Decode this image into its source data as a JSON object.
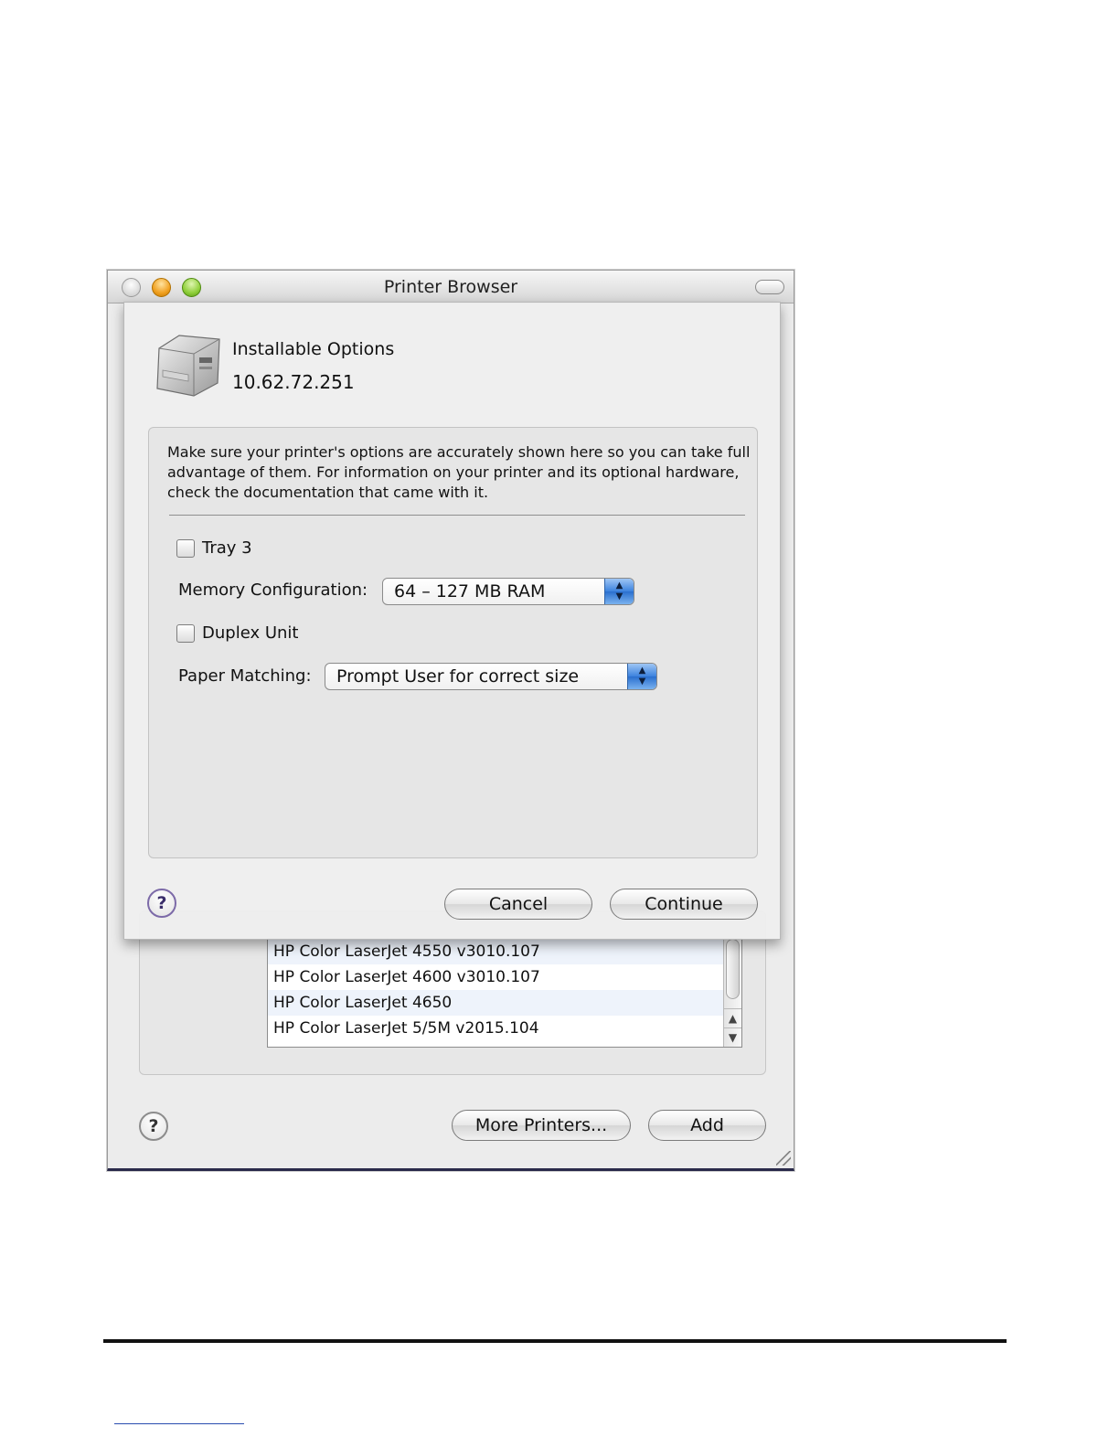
{
  "window": {
    "title": "Printer Browser",
    "help_label": "?",
    "more_printers_label": "More Printers...",
    "add_label": "Add"
  },
  "printer_list": {
    "rows": [
      "HP Color LaserJet 4550 v3010.107",
      "HP Color LaserJet 4600 v3010.107",
      "HP Color LaserJet 4650",
      "HP Color LaserJet 5/5M v2015.104"
    ],
    "scroll_up_icon": "triangle-up-icon",
    "scroll_down_icon": "triangle-down-icon"
  },
  "sheet": {
    "title": "Installable Options",
    "address": "10.62.72.251",
    "printer_icon": "laser-printer-icon",
    "instructions": "Make sure your printer's options are accurately shown here so you can take full advantage of them.  For information on your printer and its optional hardware, check the documentation that came with it.",
    "tray3_label": "Tray 3",
    "tray3_checked": false,
    "memory_label": "Memory Configuration:",
    "memory_value": "64 – 127 MB RAM",
    "duplex_label": "Duplex Unit",
    "duplex_checked": false,
    "paper_label": "Paper Matching:",
    "paper_value": "Prompt User for correct size",
    "help_label": "?",
    "cancel_label": "Cancel",
    "continue_label": "Continue"
  },
  "colors": {
    "popup_accent": "#3b82de",
    "help_ring": "#7c6aa8"
  }
}
